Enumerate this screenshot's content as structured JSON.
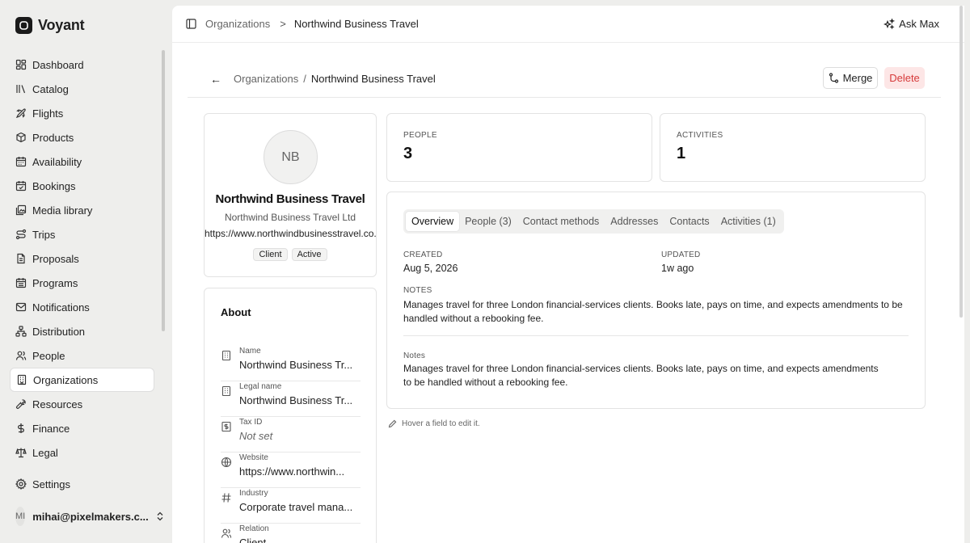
{
  "app": {
    "name": "Voyant"
  },
  "sidebar": {
    "items": [
      {
        "label": "Dashboard",
        "icon": "dashboard-icon"
      },
      {
        "label": "Catalog",
        "icon": "catalog-icon"
      },
      {
        "label": "Flights",
        "icon": "plane-icon"
      },
      {
        "label": "Products",
        "icon": "package-icon"
      },
      {
        "label": "Availability",
        "icon": "calendar-grid-icon"
      },
      {
        "label": "Bookings",
        "icon": "calendar-check-icon"
      },
      {
        "label": "Media library",
        "icon": "image-icon"
      },
      {
        "label": "Trips",
        "icon": "route-icon"
      },
      {
        "label": "Proposals",
        "icon": "document-icon"
      },
      {
        "label": "Programs",
        "icon": "calendar-icon"
      },
      {
        "label": "Notifications",
        "icon": "mail-icon"
      },
      {
        "label": "Distribution",
        "icon": "network-icon"
      },
      {
        "label": "People",
        "icon": "people-icon"
      },
      {
        "label": "Organizations",
        "icon": "building-icon",
        "active": true
      },
      {
        "label": "Resources",
        "icon": "wrench-icon"
      },
      {
        "label": "Finance",
        "icon": "dollar-icon"
      },
      {
        "label": "Legal",
        "icon": "scale-icon"
      }
    ],
    "settings": "Settings",
    "user": {
      "initials": "MI",
      "email": "mihai@pixelmakers.c..."
    }
  },
  "topbar": {
    "crumb": "Organizations",
    "separator": ">",
    "current": "Northwind Business Travel",
    "ask_label": "Ask Max"
  },
  "subheader": {
    "back": "←",
    "crumb": "Organizations",
    "slash": "/",
    "current": "Northwind Business Travel",
    "merge_label": "Merge",
    "delete_label": "Delete"
  },
  "profile": {
    "initials": "NB",
    "name": "Northwind Business Travel",
    "legal_name": "Northwind Business Travel Ltd",
    "website": "https://www.northwindbusinesstravel.co.uk",
    "badges": [
      "Client",
      "Active"
    ]
  },
  "about": {
    "title": "About",
    "fields": [
      {
        "label": "Name",
        "value": "Northwind Business Tr...",
        "icon": "building-icon"
      },
      {
        "label": "Legal name",
        "value": "Northwind Business Tr...",
        "icon": "building-icon"
      },
      {
        "label": "Tax ID",
        "value": "Not set",
        "icon": "receipt-icon",
        "muted": true
      },
      {
        "label": "Website",
        "value": "https://www.northwin...",
        "icon": "globe-icon"
      },
      {
        "label": "Industry",
        "value": "Corporate travel mana...",
        "icon": "hash-icon"
      },
      {
        "label": "Relation",
        "value": "Client",
        "icon": "people-icon"
      }
    ]
  },
  "stats": {
    "people": {
      "label": "PEOPLE",
      "value": "3"
    },
    "activities": {
      "label": "ACTIVITIES",
      "value": "1"
    }
  },
  "tabs": [
    "Overview",
    "People (3)",
    "Contact methods",
    "Addresses",
    "Contacts",
    "Activities (1)"
  ],
  "active_tab": "Overview",
  "overview": {
    "created_label": "CREATED",
    "created_value": "Aug 5, 2026",
    "updated_label": "UPDATED",
    "updated_value": "1w ago",
    "notes_label": "NOTES",
    "notes_text": "Manages travel for three London financial-services clients. Books late, pays on time, and expects amendments to be handled without a rebooking fee.",
    "notes_field_label": "Notes",
    "notes_field_text": "Manages travel for three London financial-services clients. Books late, pays on time, and expects amendments to be handled without a rebooking fee."
  },
  "hint": "Hover a field to edit it."
}
